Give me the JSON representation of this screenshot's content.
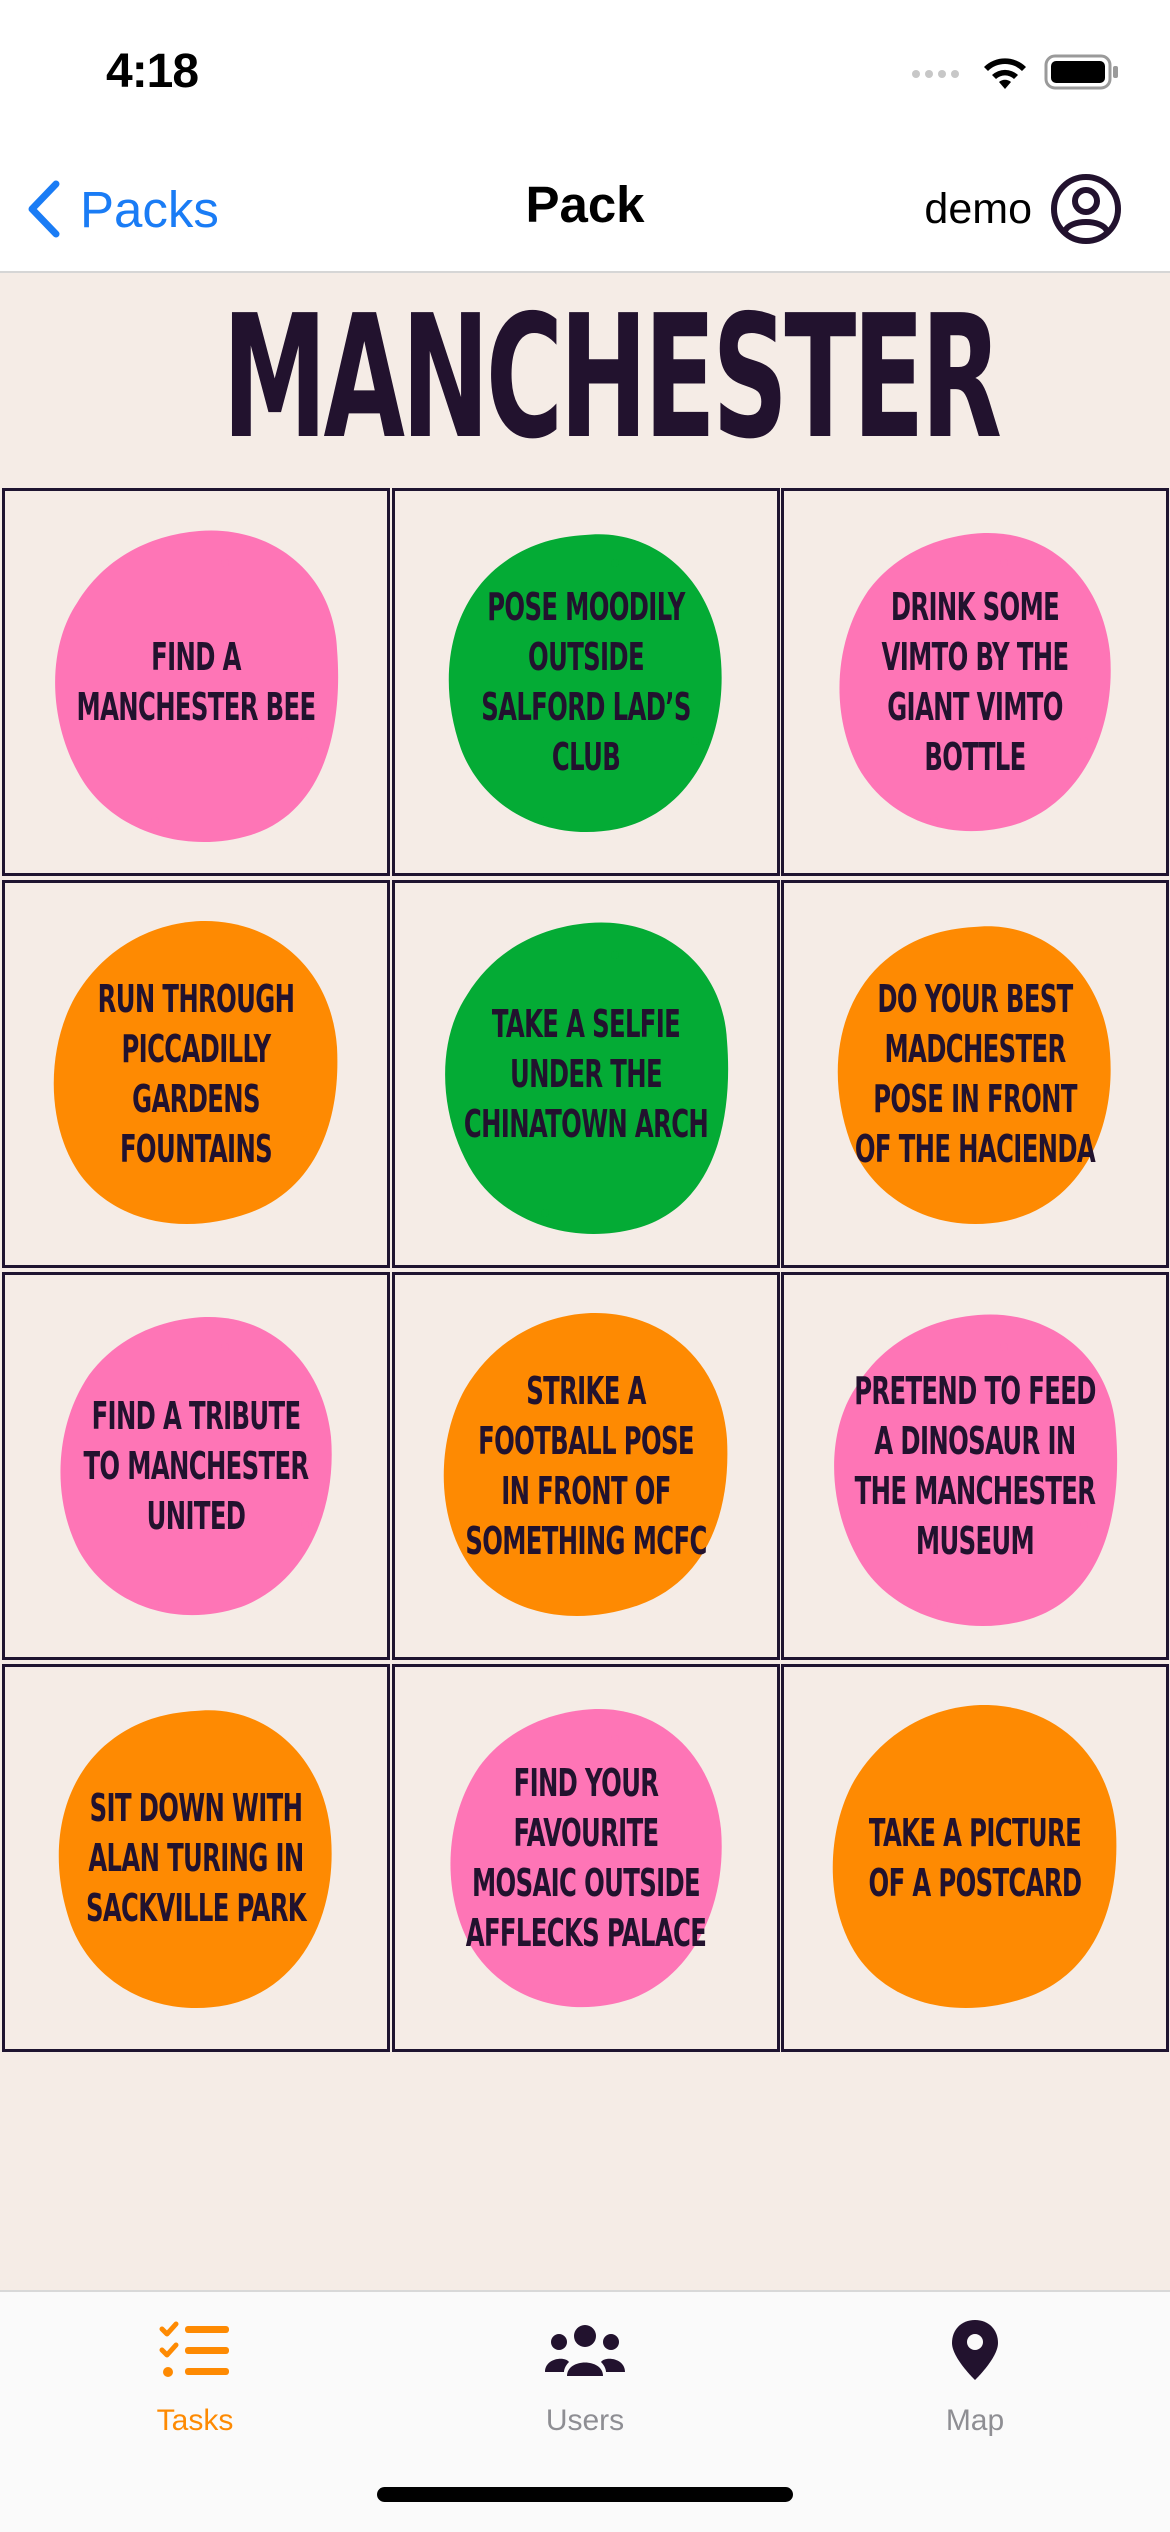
{
  "status": {
    "time": "4:18"
  },
  "nav": {
    "back_label": "Packs",
    "title": "Pack",
    "user_label": "demo"
  },
  "pack": {
    "title": "MANCHESTER",
    "tasks": [
      {
        "text": "Find a Manchester Bee",
        "color": "#fe75b6"
      },
      {
        "text": "Pose moodily outside Salford Lad’s Club",
        "color": "#04ab35"
      },
      {
        "text": "Drink some Vimto by the giant Vimto bottle",
        "color": "#fe75b6"
      },
      {
        "text": "Run through Piccadilly Gardens fountains",
        "color": "#fe8a02"
      },
      {
        "text": "Take a selfie under the Chinatown arch",
        "color": "#04ab35"
      },
      {
        "text": "Do your best Madchester pose in front of the Hacienda",
        "color": "#fe8a02"
      },
      {
        "text": "Find a tribute to Manchester United",
        "color": "#fe75b6"
      },
      {
        "text": "Strike a football pose in front of something MCFC",
        "color": "#fe8a02"
      },
      {
        "text": "Pretend to feed a dinosaur in the Manchester Museum",
        "color": "#fe75b6"
      },
      {
        "text": "Sit down with Alan Turing in Sackville Park",
        "color": "#fe8a02"
      },
      {
        "text": "Find your favourite mosaic outside Afflecks Palace",
        "color": "#fe75b6"
      },
      {
        "text": "Take a picture of a postcard",
        "color": "#fe8a02"
      }
    ]
  },
  "tabs": [
    {
      "label": "Tasks",
      "icon": "tasks-list-icon",
      "active": true
    },
    {
      "label": "Users",
      "icon": "users-group-icon",
      "active": false
    },
    {
      "label": "Map",
      "icon": "map-pin-icon",
      "active": false
    }
  ],
  "colors": {
    "accent": "#fe8a02",
    "link": "#1a7cf5",
    "background": "#f5ece6",
    "ink": "#22122e",
    "pink": "#fe75b6",
    "green": "#04ab35",
    "orange": "#fe8a02",
    "tab_inactive": "#8e8e93"
  }
}
